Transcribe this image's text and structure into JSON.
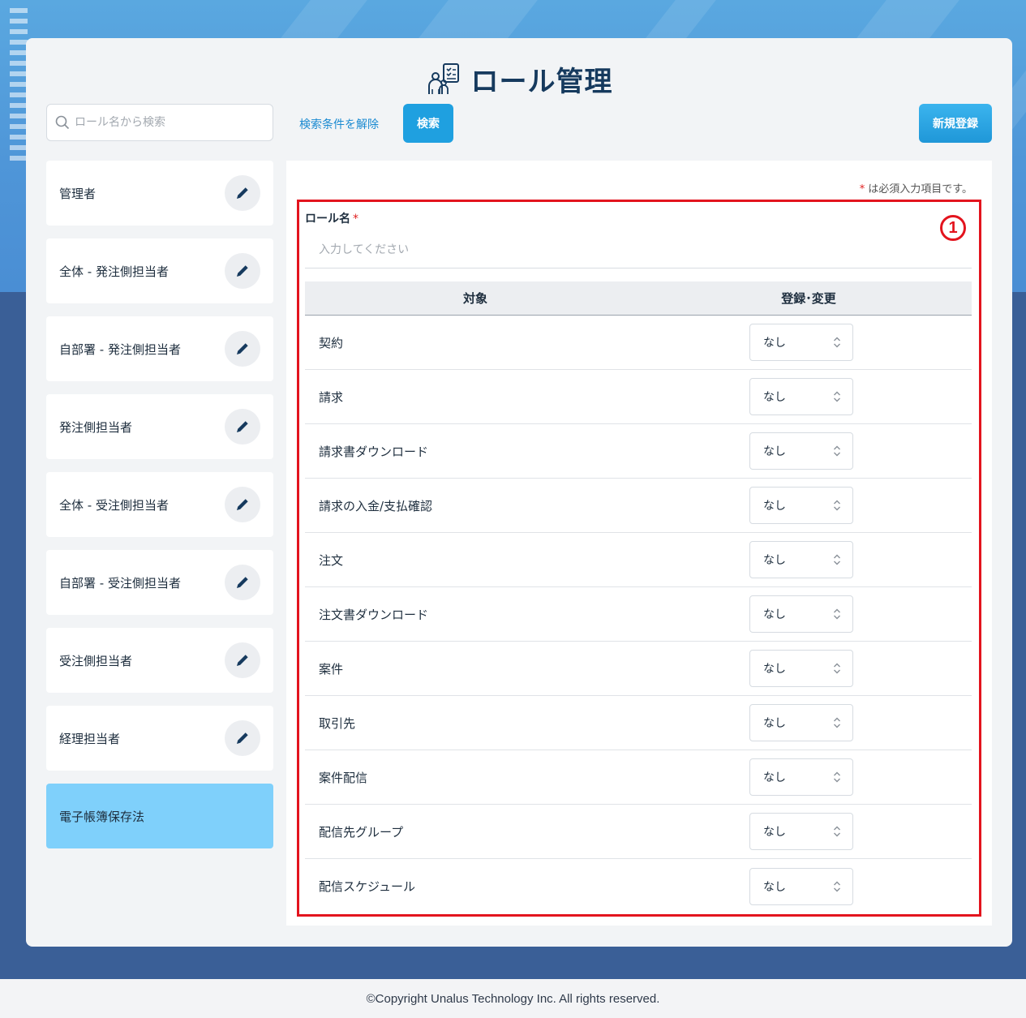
{
  "page": {
    "title": "ロール管理",
    "title_icon": "role-management-icon"
  },
  "toolbar": {
    "search_placeholder": "ロール名から検索",
    "clear_label": "検索条件を解除",
    "search_label": "検索",
    "new_label": "新規登録"
  },
  "roles": [
    {
      "label": "管理者"
    },
    {
      "label": "全体 - 発注側担当者"
    },
    {
      "label": "自部署 - 発注側担当者"
    },
    {
      "label": "発注側担当者"
    },
    {
      "label": "全体 - 受注側担当者"
    },
    {
      "label": "自部署 - 受注側担当者"
    },
    {
      "label": "受注側担当者"
    },
    {
      "label": "経理担当者"
    },
    {
      "label": "電子帳簿保存法",
      "active": true
    }
  ],
  "form": {
    "required_mark": "*",
    "required_note": "は必須入力項目です。",
    "annotation": "1",
    "role_name_label": "ロール名",
    "role_name_placeholder": "入力してください",
    "col_target": "対象",
    "col_permission": "登録･変更",
    "rows": [
      {
        "target": "契約",
        "value": "なし"
      },
      {
        "target": "請求",
        "value": "なし"
      },
      {
        "target": "請求書ダウンロード",
        "value": "なし"
      },
      {
        "target": "請求の入金/支払確認",
        "value": "なし"
      },
      {
        "target": "注文",
        "value": "なし"
      },
      {
        "target": "注文書ダウンロード",
        "value": "なし"
      },
      {
        "target": "案件",
        "value": "なし"
      },
      {
        "target": "取引先",
        "value": "なし"
      },
      {
        "target": "案件配信",
        "value": "なし"
      },
      {
        "target": "配信先グループ",
        "value": "なし"
      },
      {
        "target": "配信スケジュール",
        "value": "なし"
      }
    ]
  },
  "footer": {
    "copyright": "©Copyright Unalus Technology Inc. All rights reserved."
  },
  "colors": {
    "accent": "#1fa0e0",
    "active_role": "#7fd0fb",
    "annotation_red": "#e3141e",
    "background_blue": "#3a5f97"
  }
}
